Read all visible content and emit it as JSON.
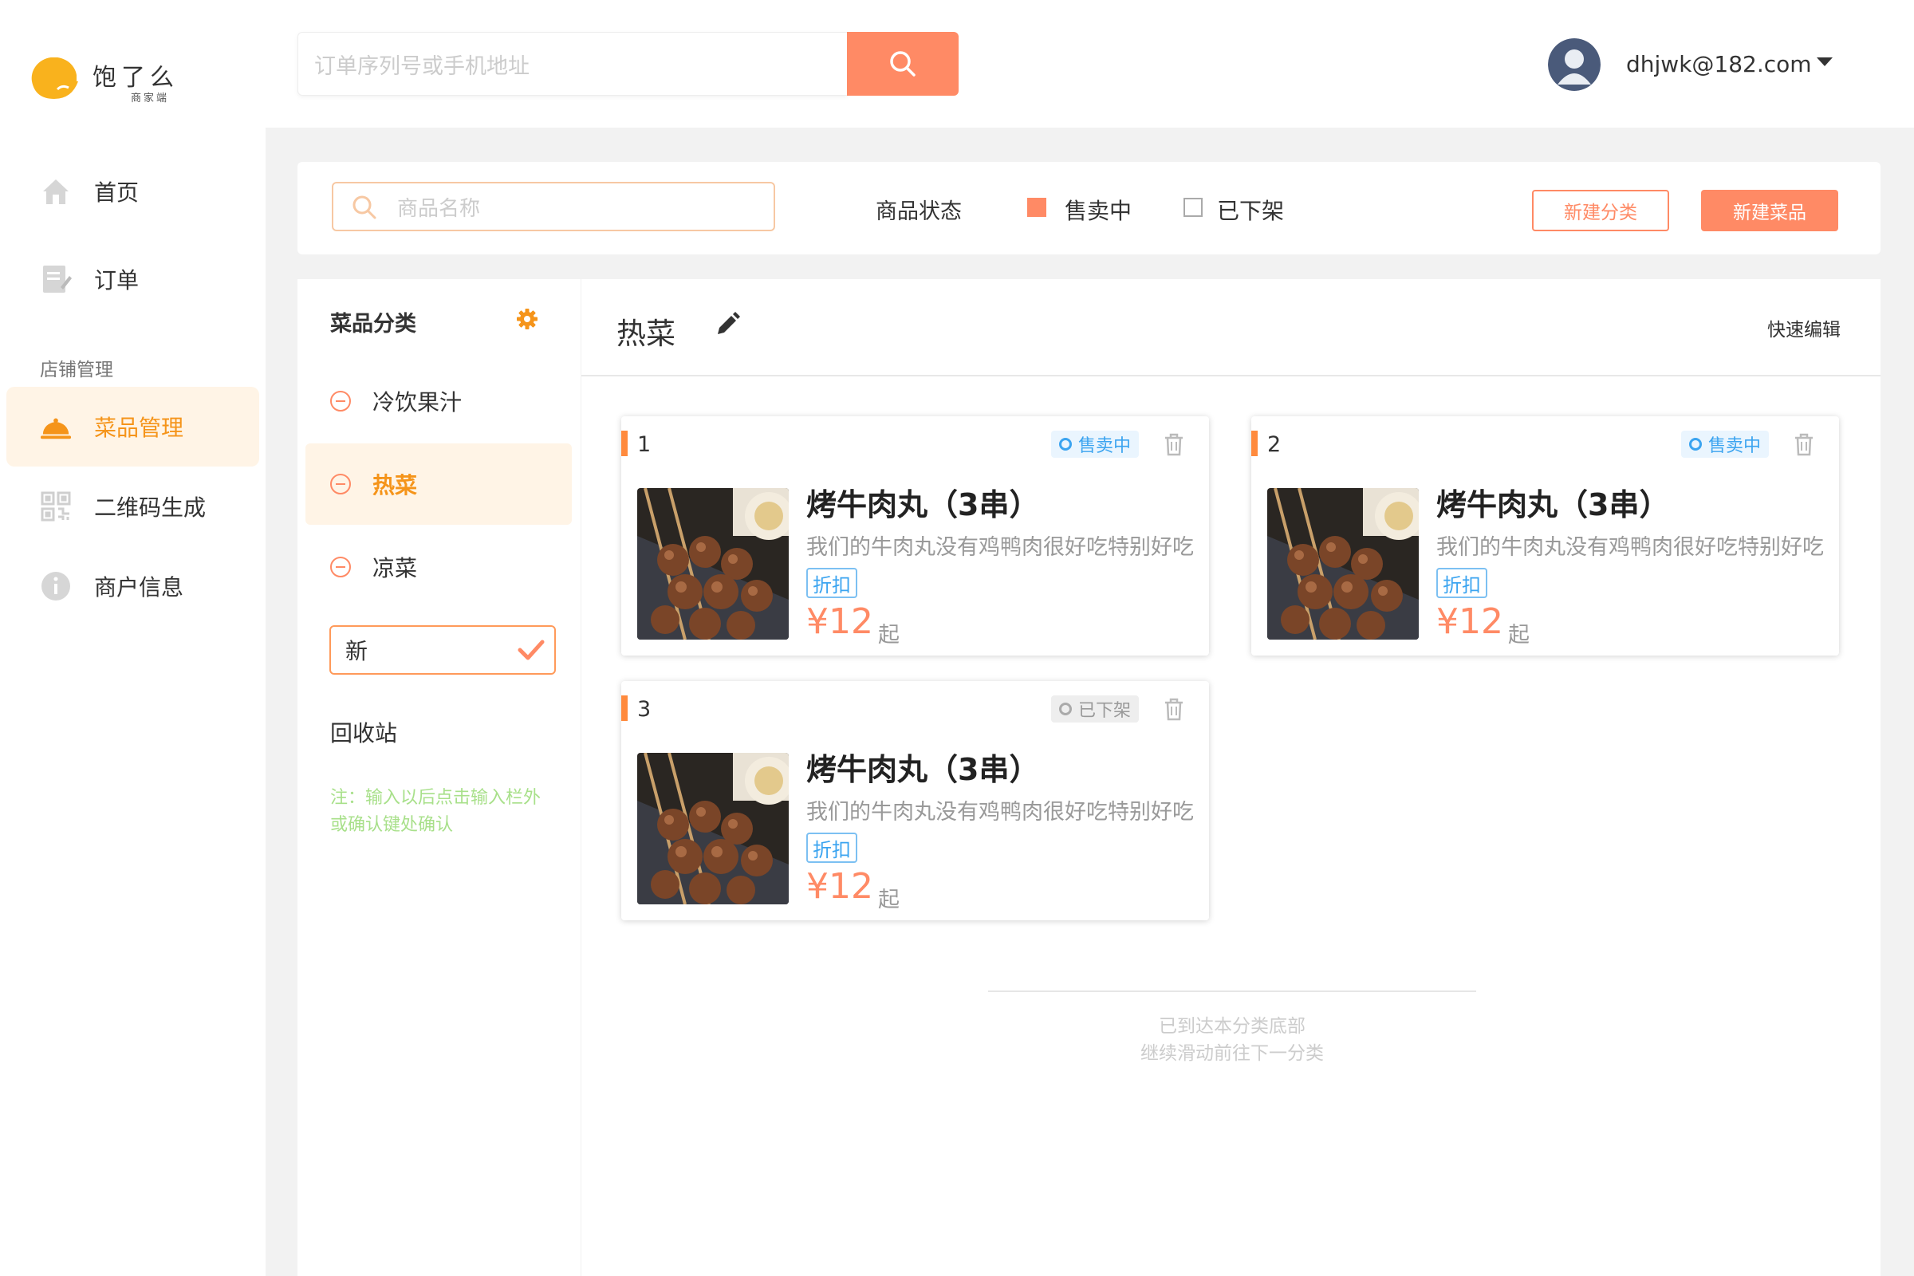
{
  "app": {
    "name": "饱了么",
    "subtitle": "商家端",
    "brand_color": "#f5941a",
    "accent_color": "#ff8a65"
  },
  "sidebar": {
    "items": [
      {
        "label": "首页",
        "icon": "home-icon"
      },
      {
        "label": "订单",
        "icon": "order-icon"
      }
    ],
    "section_label": "店铺管理",
    "section_items": [
      {
        "label": "菜品管理",
        "icon": "dish-cover-icon",
        "active": true
      },
      {
        "label": "二维码生成",
        "icon": "qrcode-icon"
      },
      {
        "label": "商户信息",
        "icon": "info-icon"
      }
    ]
  },
  "header": {
    "search_placeholder": "订单序列号或手机地址",
    "user_email": "dhjwk@182.com"
  },
  "filter": {
    "goods_placeholder": "商品名称",
    "status_label": "商品状态",
    "options": [
      {
        "label": "售卖中",
        "checked": true
      },
      {
        "label": "已下架",
        "checked": false
      }
    ],
    "new_category": "新建分类",
    "new_dish": "新建菜品"
  },
  "categories": {
    "title": "菜品分类",
    "items": [
      {
        "label": "冷饮果汁",
        "active": false
      },
      {
        "label": "热菜",
        "active": true
      },
      {
        "label": "凉菜",
        "active": false
      }
    ],
    "input_value": "新",
    "recycle": "回收站",
    "note": "注：输入以后点击输入栏外或确认键处确认"
  },
  "main": {
    "title": "热菜",
    "quick_edit": "快速编辑",
    "cards": [
      {
        "index": "1",
        "status": "售卖中",
        "status_type": "sale",
        "name": "烤牛肉丸（3串）",
        "desc": "我们的牛肉丸没有鸡鸭肉很好吃特别好吃",
        "tag": "折扣",
        "price": "¥12",
        "price_suffix": "起"
      },
      {
        "index": "2",
        "status": "售卖中",
        "status_type": "sale",
        "name": "烤牛肉丸（3串）",
        "desc": "我们的牛肉丸没有鸡鸭肉很好吃特别好吃",
        "tag": "折扣",
        "price": "¥12",
        "price_suffix": "起"
      },
      {
        "index": "3",
        "status": "已下架",
        "status_type": "off",
        "name": "烤牛肉丸（3串）",
        "desc": "我们的牛肉丸没有鸡鸭肉很好吃特别好吃",
        "tag": "折扣",
        "price": "¥12",
        "price_suffix": "起"
      }
    ],
    "end_line1": "已到达本分类底部",
    "end_line2": "继续滑动前往下一分类"
  }
}
